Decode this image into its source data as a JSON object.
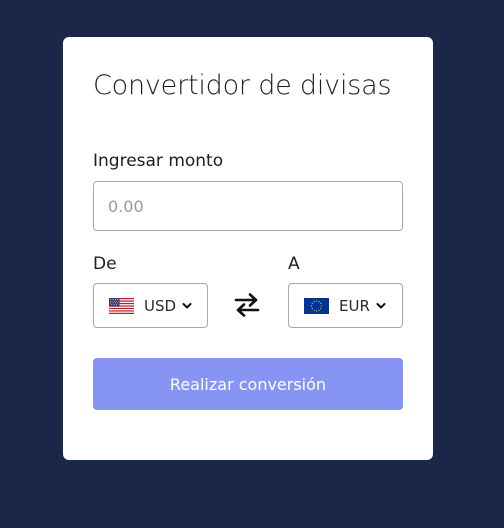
{
  "converter": {
    "title": "Convertidor de divisas",
    "amount_label": "Ingresar monto",
    "amount_placeholder": "0.00",
    "amount_value": "",
    "from": {
      "label": "De",
      "currency": "USD",
      "flag_icon": "us-flag-icon"
    },
    "to": {
      "label": "A",
      "currency": "EUR",
      "flag_icon": "eu-flag-icon"
    },
    "swap_icon": "swap-arrows-icon",
    "convert_label": "Realizar conversión"
  },
  "colors": {
    "background": "#1b2748",
    "card": "#ffffff",
    "button": "#8695f3",
    "button_text": "#ffffff",
    "border": "#a6a6a6"
  }
}
